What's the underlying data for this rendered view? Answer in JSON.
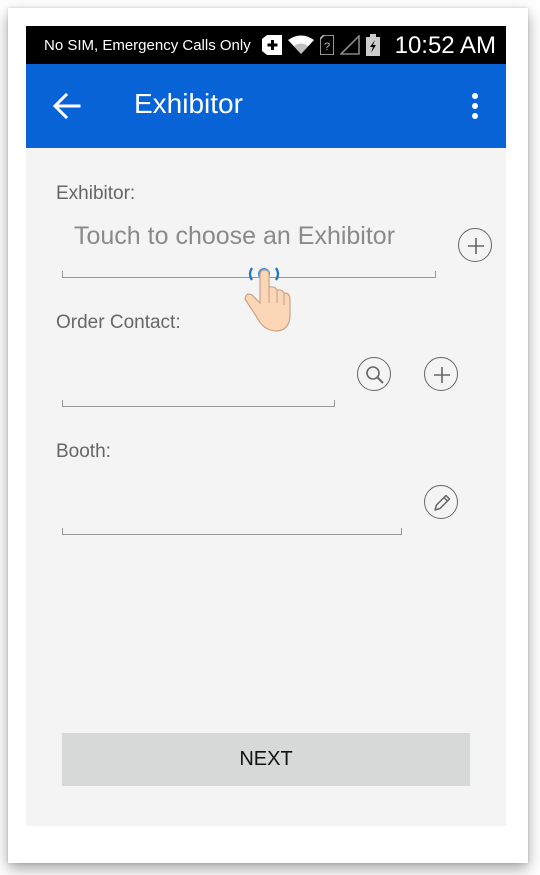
{
  "status_bar": {
    "carrier": "No SIM, Emergency Calls Only",
    "time": "10:52 AM",
    "icons": [
      "plus-box-icon",
      "wifi-icon",
      "sim-icon",
      "signal-icon",
      "battery-icon"
    ]
  },
  "app_bar": {
    "title": "Exhibitor",
    "color": "#0863d6"
  },
  "form": {
    "exhibitor_label": "Exhibitor:",
    "exhibitor_placeholder": "Touch to choose an Exhibitor",
    "order_contact_label": "Order Contact:",
    "order_contact_value": "",
    "booth_label": "Booth:",
    "booth_value": ""
  },
  "next_button": "NEXT"
}
